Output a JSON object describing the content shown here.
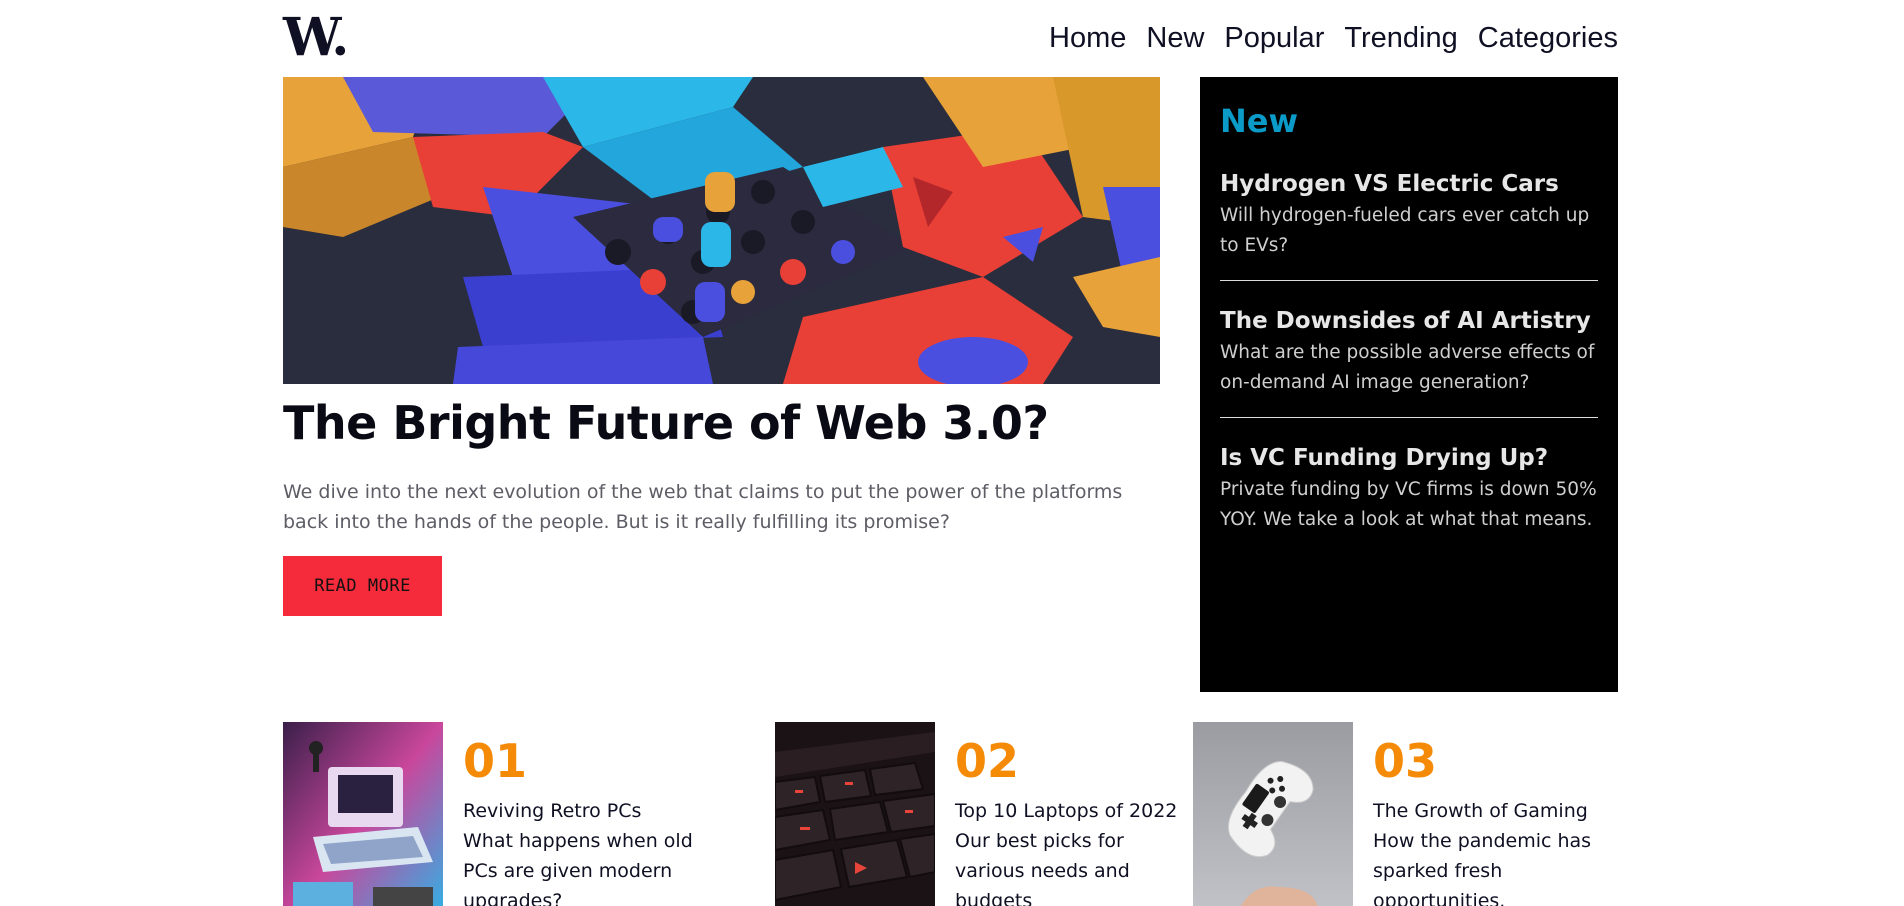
{
  "header": {
    "logo": "W.",
    "nav": [
      "Home",
      "New",
      "Popular",
      "Trending",
      "Categories"
    ]
  },
  "hero": {
    "title": "The Bright Future of Web 3.0?",
    "description": "We dive into the next evolution of the web that claims to put the power of the platforms back into the hands of the people. But is it really fulfilling its promise?",
    "button_label": "READ MORE",
    "image_icon": "abstract-3d-blocks-image"
  },
  "new_panel": {
    "heading": "New",
    "items": [
      {
        "title": "Hydrogen VS Electric Cars",
        "description": "Will hydrogen-fueled cars ever catch up to EVs?"
      },
      {
        "title": "The Downsides of AI Artistry",
        "description": "What are the possible adverse effects of on-demand AI image generation?"
      },
      {
        "title": "Is VC Funding Drying Up?",
        "description": "Private funding by VC firms is down 50% YOY. We take a look at what that means."
      }
    ]
  },
  "articles": [
    {
      "number": "01",
      "title": "Reviving Retro PCs",
      "description": "What happens when old PCs are given modern upgrades?",
      "image_icon": "retro-pc-image"
    },
    {
      "number": "02",
      "title": "Top 10 Laptops of 2022",
      "description": "Our best picks for various needs and budgets",
      "image_icon": "keyboard-image"
    },
    {
      "number": "03",
      "title": "The Growth of Gaming",
      "description": "How the pandemic has sparked fresh opportunities.",
      "image_icon": "game-controller-image"
    }
  ],
  "colors": {
    "accent_red": "#f52b3b",
    "accent_cyan": "#0b9bc9",
    "accent_orange": "#f58a06",
    "dark": "#0f1023"
  }
}
